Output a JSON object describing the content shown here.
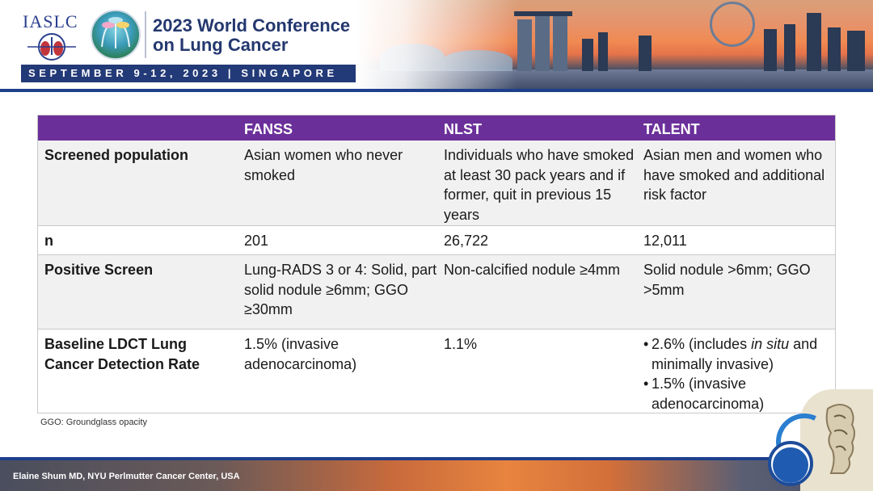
{
  "header": {
    "org_logo_text": "IASLC",
    "conference_title_line1": "2023 World Conference",
    "conference_title_line2": "on Lung Cancer",
    "date_location": "SEPTEMBER 9-12, 2023 | SINGAPORE"
  },
  "table": {
    "columns": [
      "",
      "FANSS",
      "NLST",
      "TALENT"
    ],
    "rows": [
      {
        "label": "Screened population",
        "fanss": "Asian women who never smoked",
        "nlst": "Individuals who have smoked at least 30 pack years and if former, quit in previous 15 years",
        "talent": "Asian men and women who have smoked and additional risk factor"
      },
      {
        "label": "n",
        "fanss": "201",
        "nlst": "26,722",
        "talent": "12,011"
      },
      {
        "label": "Positive Screen",
        "fanss": "Lung-RADS 3 or 4: Solid, part solid nodule ≥6mm; GGO ≥30mm",
        "nlst": "Non-calcified nodule ≥4mm",
        "talent": "Solid nodule >6mm; GGO >5mm"
      },
      {
        "label": "Baseline LDCT Lung Cancer Detection Rate",
        "fanss": "1.5% (invasive adenocarcinoma)",
        "nlst": "1.1%",
        "talent_bullets": [
          {
            "before": "2.6% (includes ",
            "italic": "in situ",
            "after": " and minimally invasive)"
          },
          {
            "before": "1.5% (invasive adenocarcinoma)",
            "italic": "",
            "after": ""
          }
        ]
      }
    ]
  },
  "footnote": "GGO: Groundglass opacity",
  "footer": {
    "presenter": "Elaine Shum MD, NYU Perlmutter Cancer Center, USA"
  },
  "colors": {
    "header_purple": "#6b2f9a",
    "navy": "#233a78",
    "row_alt": "#f1f1f1"
  }
}
